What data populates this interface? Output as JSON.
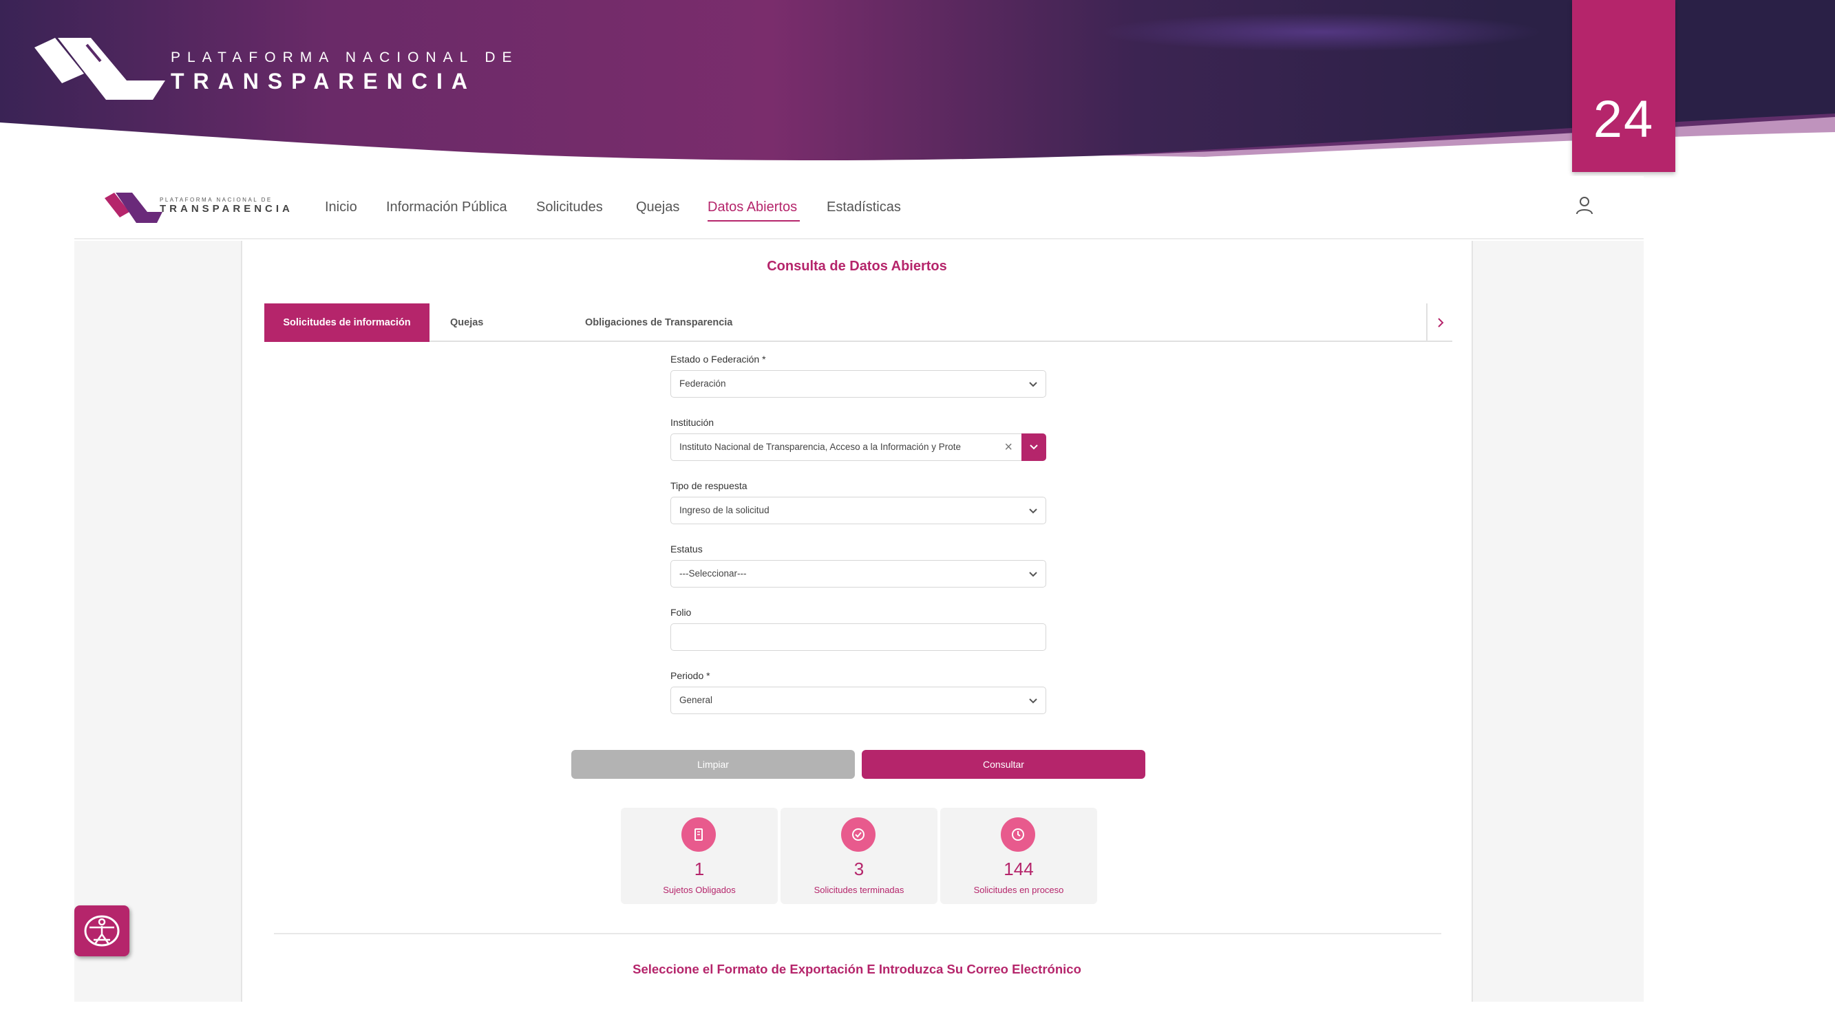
{
  "slide": {
    "brand_line1": "PLATAFORMA NACIONAL DE",
    "brand_line2": "TRANSPARENCIA",
    "page_number": "24"
  },
  "nav": {
    "logo_line1": "PLATAFORMA NACIONAL DE",
    "logo_line2": "TRANSPARENCIA",
    "items": [
      "Inicio",
      "Información Pública",
      "Solicitudes",
      "Quejas",
      "Datos Abiertos",
      "Estadísticas"
    ],
    "active_item": "Datos Abiertos"
  },
  "page": {
    "title": "Consulta de Datos Abiertos",
    "tabs": [
      "Solicitudes de información",
      "Quejas",
      "Obligaciones de Transparencia"
    ],
    "active_tab": "Solicitudes de información"
  },
  "form": {
    "estado": {
      "label": "Estado o Federación *",
      "value": "Federación"
    },
    "institucion": {
      "label": "Institución",
      "value": "Instituto Nacional de Transparencia, Acceso a la Información y Prote"
    },
    "tipo_respuesta": {
      "label": "Tipo de respuesta",
      "value": "Ingreso de la solicitud"
    },
    "estatus": {
      "label": "Estatus",
      "value": "---Seleccionar---"
    },
    "folio": {
      "label": "Folio",
      "value": ""
    },
    "periodo": {
      "label": "Periodo *",
      "value": "General"
    }
  },
  "buttons": {
    "limpiar": "Limpiar",
    "consultar": "Consultar"
  },
  "stats": [
    {
      "value": "1",
      "label": "Sujetos Obligados",
      "icon": "building-icon"
    },
    {
      "value": "3",
      "label": "Solicitudes terminadas",
      "icon": "check-circle-icon"
    },
    {
      "value": "144",
      "label": "Solicitudes en proceso",
      "icon": "clock-icon"
    }
  ],
  "export_heading": "Seleccione el Formato de Exportación E Introduzca Su Correo Electrónico",
  "colors": {
    "brand_magenta": "#b5256b",
    "stat_icon_pink": "#e85a8d",
    "banner_dark": "#2a2046",
    "banner_purple": "#7a2a6e"
  }
}
